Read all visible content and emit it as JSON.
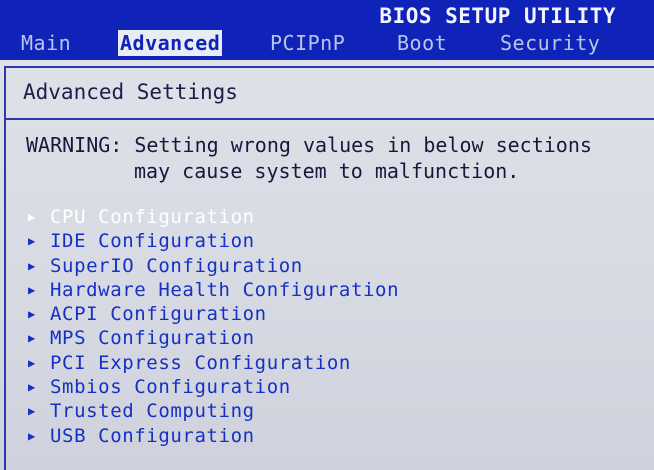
{
  "header": {
    "utility_title": "BIOS SETUP UTILITY"
  },
  "tabs": [
    {
      "label": "Main",
      "active": false
    },
    {
      "label": "Advanced",
      "active": true
    },
    {
      "label": "PCIPnP",
      "active": false
    },
    {
      "label": "Boot",
      "active": false
    },
    {
      "label": "Security",
      "active": false
    }
  ],
  "panel": {
    "title": "Advanced Settings",
    "warning_line1": "WARNING: Setting wrong values in below sections",
    "warning_line2": "may cause system to malfunction."
  },
  "menu": {
    "items": [
      {
        "label": "CPU Configuration",
        "selected": true
      },
      {
        "label": "IDE Configuration",
        "selected": false
      },
      {
        "label": "SuperIO Configuration",
        "selected": false
      },
      {
        "label": "Hardware Health Configuration",
        "selected": false
      },
      {
        "label": "ACPI Configuration",
        "selected": false
      },
      {
        "label": "MPS Configuration",
        "selected": false
      },
      {
        "label": "PCI Express Configuration",
        "selected": false
      },
      {
        "label": "Smbios Configuration",
        "selected": false
      },
      {
        "label": "Trusted Computing",
        "selected": false
      },
      {
        "label": "USB Configuration",
        "selected": false
      }
    ],
    "arrow_icon": "right-triangle-icon"
  },
  "colors": {
    "header_background": "#0f23b8",
    "panel_background": "#dcdfe6",
    "menu_text": "#1530c4",
    "selected_text": "#ffffff",
    "active_tab_background": "#e8ecf4"
  }
}
